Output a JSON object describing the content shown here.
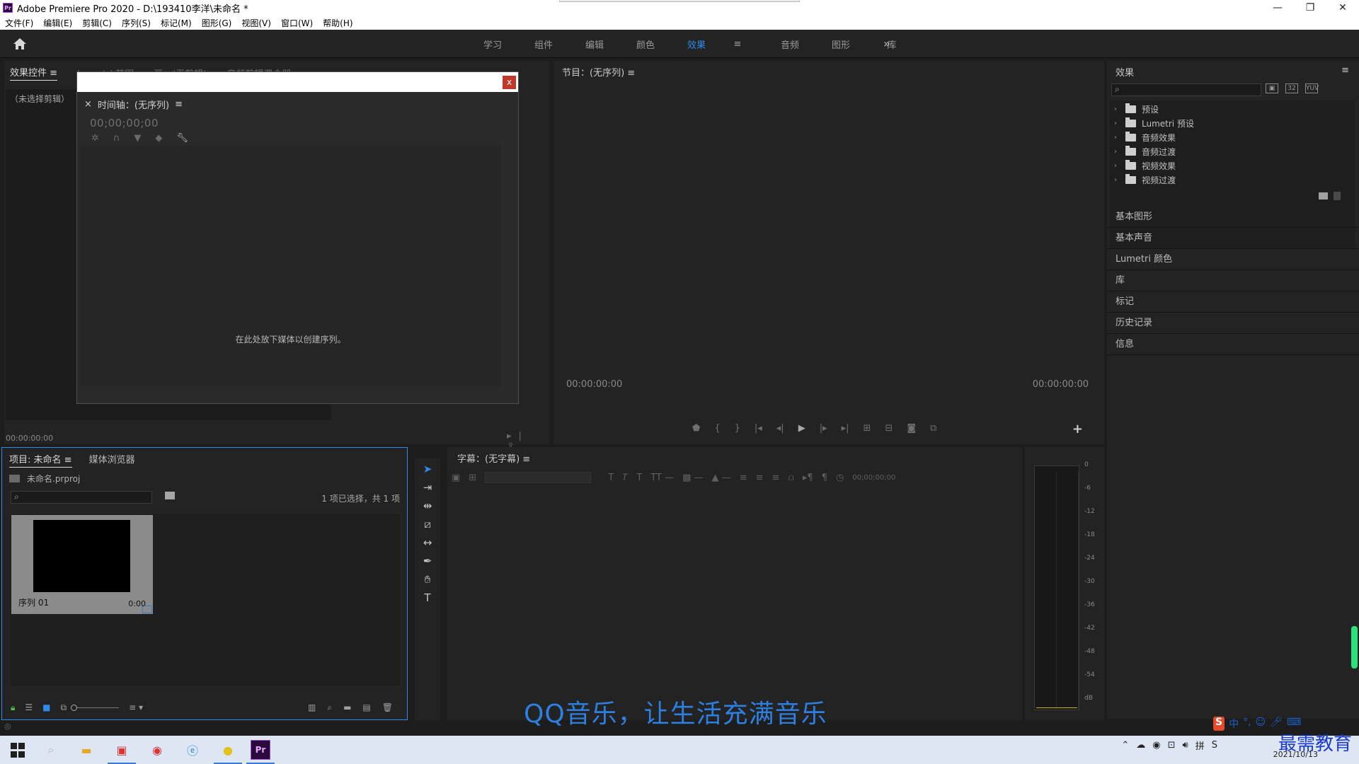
{
  "window": {
    "app_icon": "Pr",
    "title": "Adobe Premiere Pro 2020 - D:\\193410李洋\\未命名 *",
    "controls": [
      "—",
      "❐",
      "✕"
    ]
  },
  "menu": [
    "文件(F)",
    "编辑(E)",
    "剪辑(C)",
    "序列(S)",
    "标记(M)",
    "图形(G)",
    "视图(V)",
    "窗口(W)",
    "帮助(H)"
  ],
  "workspaces": {
    "tabs": [
      "学习",
      "组件",
      "编辑",
      "颜色",
      "效果",
      "音频",
      "图形",
      "库"
    ],
    "active": "效果",
    "more_glyph": "»"
  },
  "effect_controls": {
    "tabs": [
      "效果控件",
      "Lumetri 范围",
      "源：(无剪辑)",
      "音频剪辑混合器"
    ],
    "menu_glyph": "≡",
    "no_clip": "（未选择剪辑）",
    "timecode": "00:00:00:00"
  },
  "floating_window": {
    "close": "x",
    "timeline_title": "时间轴：(无序列)",
    "timecode": "00;00;00;00",
    "drop_hint": "在此处放下媒体以创建序列。"
  },
  "program": {
    "title": "节目：(无序列)",
    "tc_left": "00:00:00:00",
    "tc_right": "00:00:00:00"
  },
  "effects": {
    "title": "效果",
    "search_placeholder": "",
    "tree": [
      "预设",
      "Lumetri 预设",
      "音频效果",
      "音频过渡",
      "视频效果",
      "视频过渡"
    ],
    "sections": [
      "基本图形",
      "基本声音",
      "Lumetri 颜色",
      "库",
      "标记",
      "历史记录",
      "信息"
    ]
  },
  "project": {
    "tabs": [
      "项目: 未命名",
      "媒体浏览器"
    ],
    "file": "未命名.prproj",
    "count": "1 项已选择，共 1 项",
    "item": {
      "name": "序列 01",
      "duration": "0:00"
    }
  },
  "captions": {
    "title": "字幕：(无字幕)",
    "timecode": "00;00;00;00"
  },
  "meters": {
    "scale": [
      "0",
      "-6",
      "-12",
      "-18",
      "-24",
      "-30",
      "-36",
      "-42",
      "-48",
      "-54",
      "dB"
    ]
  },
  "overlay": {
    "subtitle": "QQ音乐，让生活充满音乐",
    "brand": "最需教育"
  },
  "taskbar": {
    "date": "2021/10/13"
  },
  "colors": {
    "accent": "#2d8ceb",
    "panel": "#232323",
    "bg": "#1d1d1d"
  }
}
